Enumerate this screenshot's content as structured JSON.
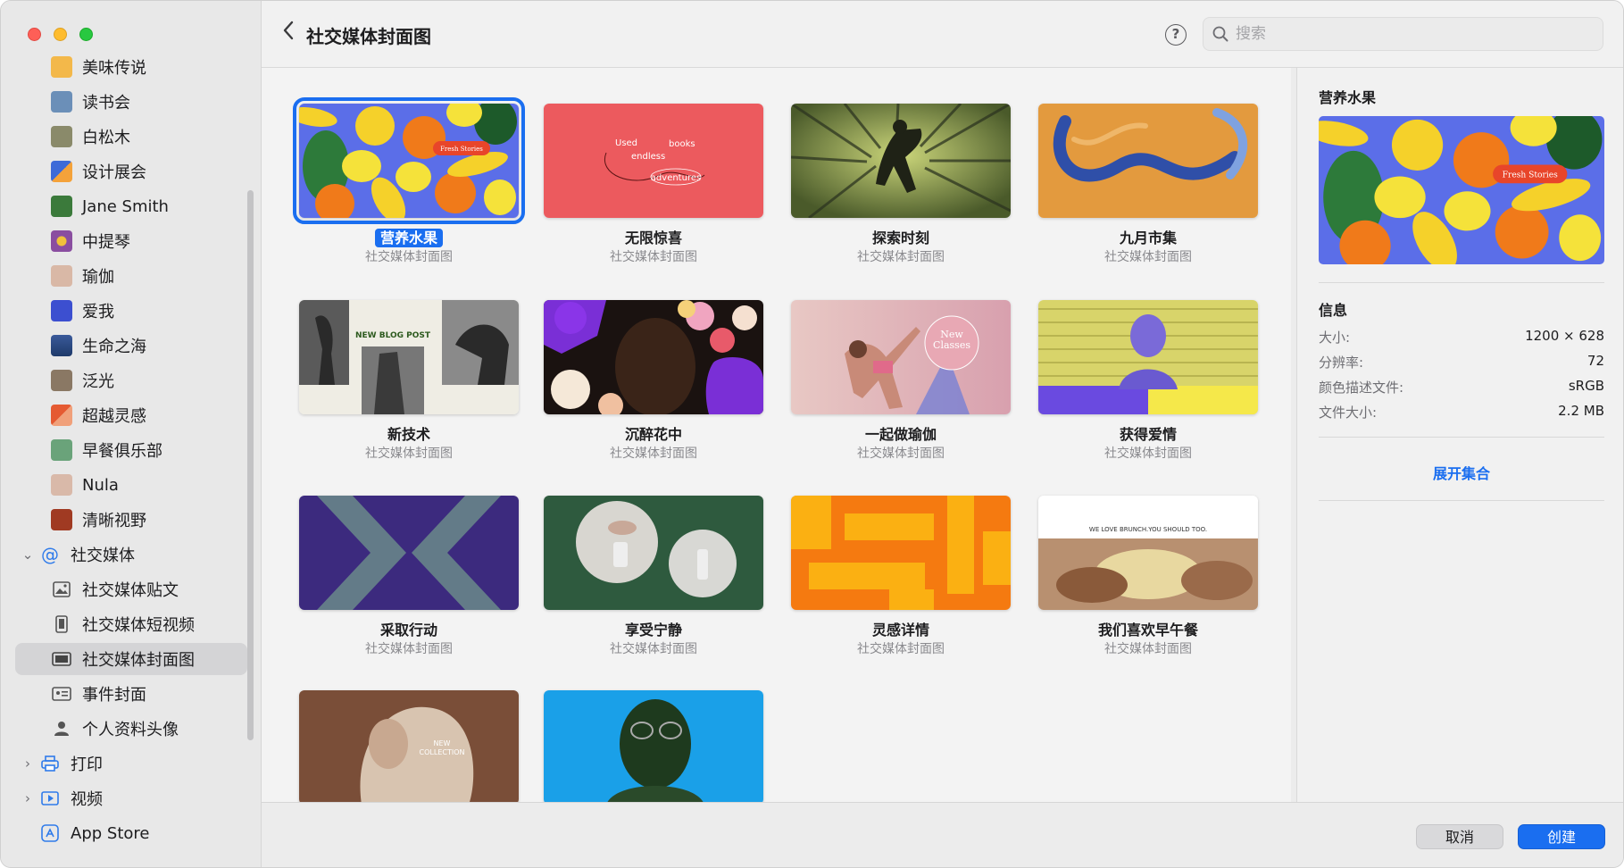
{
  "toolbar": {
    "title": "社交媒体封面图",
    "back_icon": "chevron-left-icon",
    "help_glyph": "?",
    "search_placeholder": "搜索"
  },
  "sidebar": {
    "items": [
      {
        "label": "美味传说",
        "thumb": "#f3b84a"
      },
      {
        "label": "读书会",
        "thumb": "#6b8fb8"
      },
      {
        "label": "白松木",
        "thumb": "#8a8a6a"
      },
      {
        "label": "设计展会",
        "thumb": "#3d6ad8"
      },
      {
        "label": "Jane Smith",
        "thumb": "#3b7a3b"
      },
      {
        "label": "中提琴",
        "thumb": "#8a4ea0"
      },
      {
        "label": "瑜伽",
        "thumb": "#d9b8a6"
      },
      {
        "label": "爱我",
        "thumb": "#3c4fd0"
      },
      {
        "label": "生命之海",
        "thumb": "#1e3a6a"
      },
      {
        "label": "泛光",
        "thumb": "#8a7864"
      },
      {
        "label": "超越灵感",
        "thumb": "#e55a32"
      },
      {
        "label": "早餐俱乐部",
        "thumb": "#6aa37a"
      },
      {
        "label": "Nula",
        "thumb": "#d9b9a9"
      },
      {
        "label": "清晰视野",
        "thumb": "#a03a22"
      }
    ],
    "group_social": "社交媒体",
    "social_children": [
      {
        "label": "社交媒体贴文",
        "icon": "image-icon"
      },
      {
        "label": "社交媒体短视频",
        "icon": "phone-icon"
      },
      {
        "label": "社交媒体封面图",
        "icon": "banner-icon"
      },
      {
        "label": "事件封面",
        "icon": "card-icon"
      },
      {
        "label": "个人资料头像",
        "icon": "person-icon"
      }
    ],
    "group_print": "打印",
    "group_video": "视频",
    "app_store": "App Store"
  },
  "gallery": {
    "subtitle": "社交媒体封面图",
    "cards": [
      {
        "name": "营养水果"
      },
      {
        "name": "无限惊喜"
      },
      {
        "name": "探索时刻"
      },
      {
        "name": "九月市集"
      },
      {
        "name": "新技术"
      },
      {
        "name": "沉醉花中"
      },
      {
        "name": "一起做瑜伽"
      },
      {
        "name": "获得爱情"
      },
      {
        "name": "采取行动"
      },
      {
        "name": "享受宁静"
      },
      {
        "name": "灵感详情"
      },
      {
        "name": "我们喜欢早午餐"
      }
    ],
    "thumb_text": {
      "fruit_banner": "Fresh Stories",
      "books_1": "Used",
      "books_2": "books",
      "books_3": "endless",
      "books_4": "adventures",
      "blog": "NEW BLOG POST",
      "yoga_1": "New",
      "yoga_2": "Classes",
      "brunch": "WE LOVE BRUNCH.YOU SHOULD TOO.",
      "collection_1": "NEW",
      "collection_2": "COLLECTION"
    }
  },
  "info": {
    "title": "营养水果",
    "section": "信息",
    "rows": [
      {
        "k": "大小:",
        "v": "1200 × 628"
      },
      {
        "k": "分辨率:",
        "v": "72"
      },
      {
        "k": "颜色描述文件:",
        "v": "sRGB"
      },
      {
        "k": "文件大小:",
        "v": "2.2 MB"
      }
    ],
    "expand_link": "展开集合"
  },
  "footer": {
    "cancel": "取消",
    "create": "创建"
  },
  "colors": {
    "accent": "#1a6ef0",
    "fruit_bg": "#5b6ee8"
  }
}
